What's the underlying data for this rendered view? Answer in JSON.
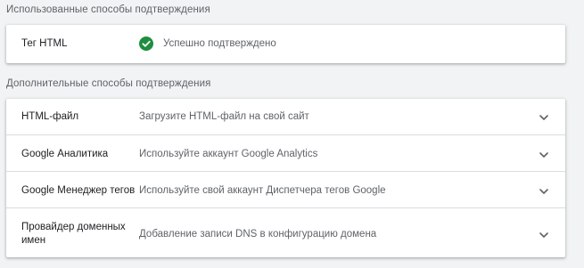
{
  "used_section": {
    "title": "Использованные способы подтверждения",
    "method": {
      "label": "Тег HTML",
      "status": "Успешно подтверждено",
      "status_icon": "check-circle-icon",
      "status_color": "#1e8e3e"
    }
  },
  "extra_section": {
    "title": "Дополнительные способы подтверждения",
    "methods": [
      {
        "label": "HTML-файл",
        "description": "Загрузите HTML-файл на свой сайт",
        "icon": "chevron-down-icon"
      },
      {
        "label": "Google Аналитика",
        "description": "Используйте аккаунт Google Analytics",
        "icon": "chevron-down-icon"
      },
      {
        "label": "Google Менеджер тегов",
        "description": "Используйте свой аккаунт Диспетчера тегов Google",
        "icon": "chevron-down-icon"
      },
      {
        "label_line1": "Провайдер доменных",
        "label_line2": "имен",
        "description": "Добавление записи DNS в конфигурацию домена",
        "icon": "chevron-down-icon"
      }
    ]
  },
  "colors": {
    "background": "#f1f3f4",
    "card": "#ffffff",
    "text_primary": "#202124",
    "text_secondary": "#5f6368",
    "divider": "#dadce0",
    "success": "#1e8e3e"
  }
}
